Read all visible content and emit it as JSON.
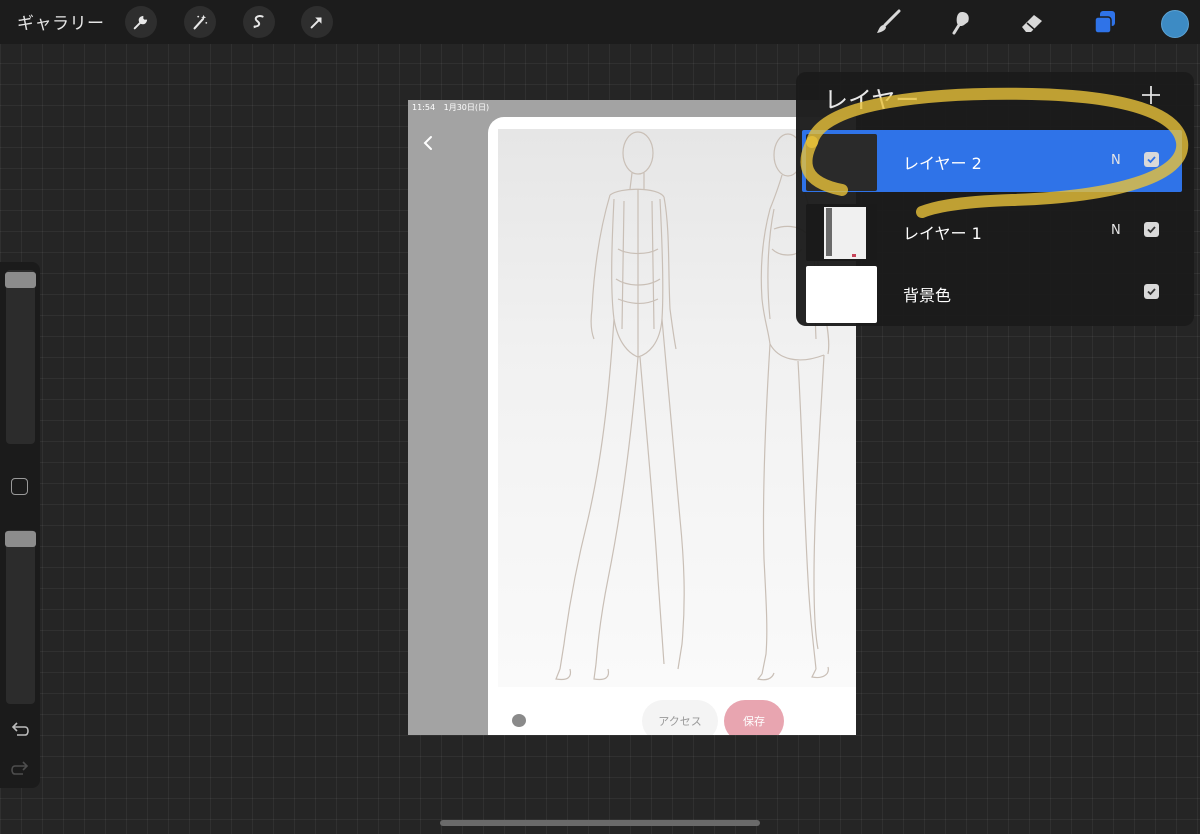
{
  "toolbar": {
    "gallery_label": "ギャラリー",
    "left_icons": [
      "wrench-icon",
      "magic-wand-icon",
      "selection-icon",
      "arrow-icon"
    ],
    "right_icons": [
      "brush-icon",
      "smudge-icon",
      "eraser-icon",
      "layers-icon"
    ],
    "active_tool": "layers-icon",
    "current_color": "#3d8bc4"
  },
  "canvas": {
    "status_time": "11:54",
    "status_date": "1月30日(日)",
    "access_label": "アクセス",
    "save_label": "保存"
  },
  "layers_panel": {
    "title": "レイヤー",
    "add_label": "+",
    "items": [
      {
        "name": "レイヤー 2",
        "mode": "N",
        "visible": true,
        "active": true
      },
      {
        "name": "レイヤー 1",
        "mode": "N",
        "visible": true,
        "active": false
      },
      {
        "name": "背景色",
        "mode": "",
        "visible": true,
        "active": false
      }
    ]
  },
  "colors": {
    "accent": "#2f73e8",
    "highlight": "#e8c23a",
    "save_button": "#e8a5b0"
  }
}
